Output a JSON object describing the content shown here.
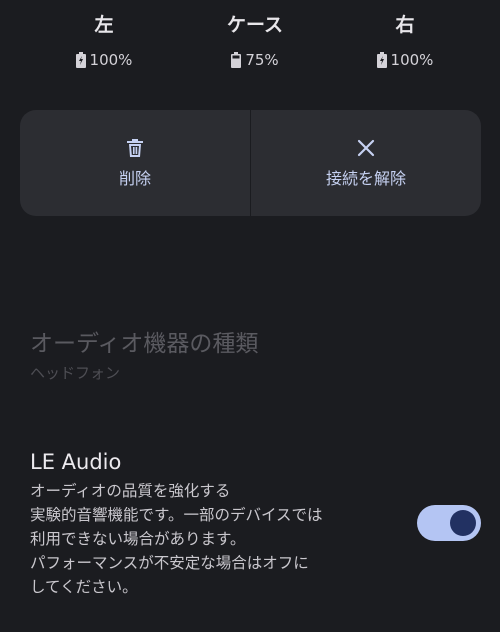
{
  "battery": {
    "left": {
      "label": "左",
      "level": "100%",
      "charging": true
    },
    "case": {
      "label": "ケース",
      "level": "75%",
      "charging": false
    },
    "right": {
      "label": "右",
      "level": "100%",
      "charging": true
    }
  },
  "actions": {
    "delete": {
      "label": "削除",
      "icon": "trash-icon"
    },
    "disconnect": {
      "label": "接続を解除",
      "icon": "close-icon"
    }
  },
  "device_type": {
    "title": "オーディオ機器の種類",
    "value": "ヘッドフォン"
  },
  "le_audio": {
    "title": "LE Audio",
    "description": "オーディオの品質を強化する\n実験的音響機能です。一部のデバイスでは\n利用できない場合があります。\nパフォーマンスが不安定な場合はオフに\nしてください。",
    "enabled": true
  },
  "colors": {
    "background": "#1b1c20",
    "card": "#2c2d32",
    "accent": "#b4c5f3",
    "toggle_thumb": "#223162"
  }
}
